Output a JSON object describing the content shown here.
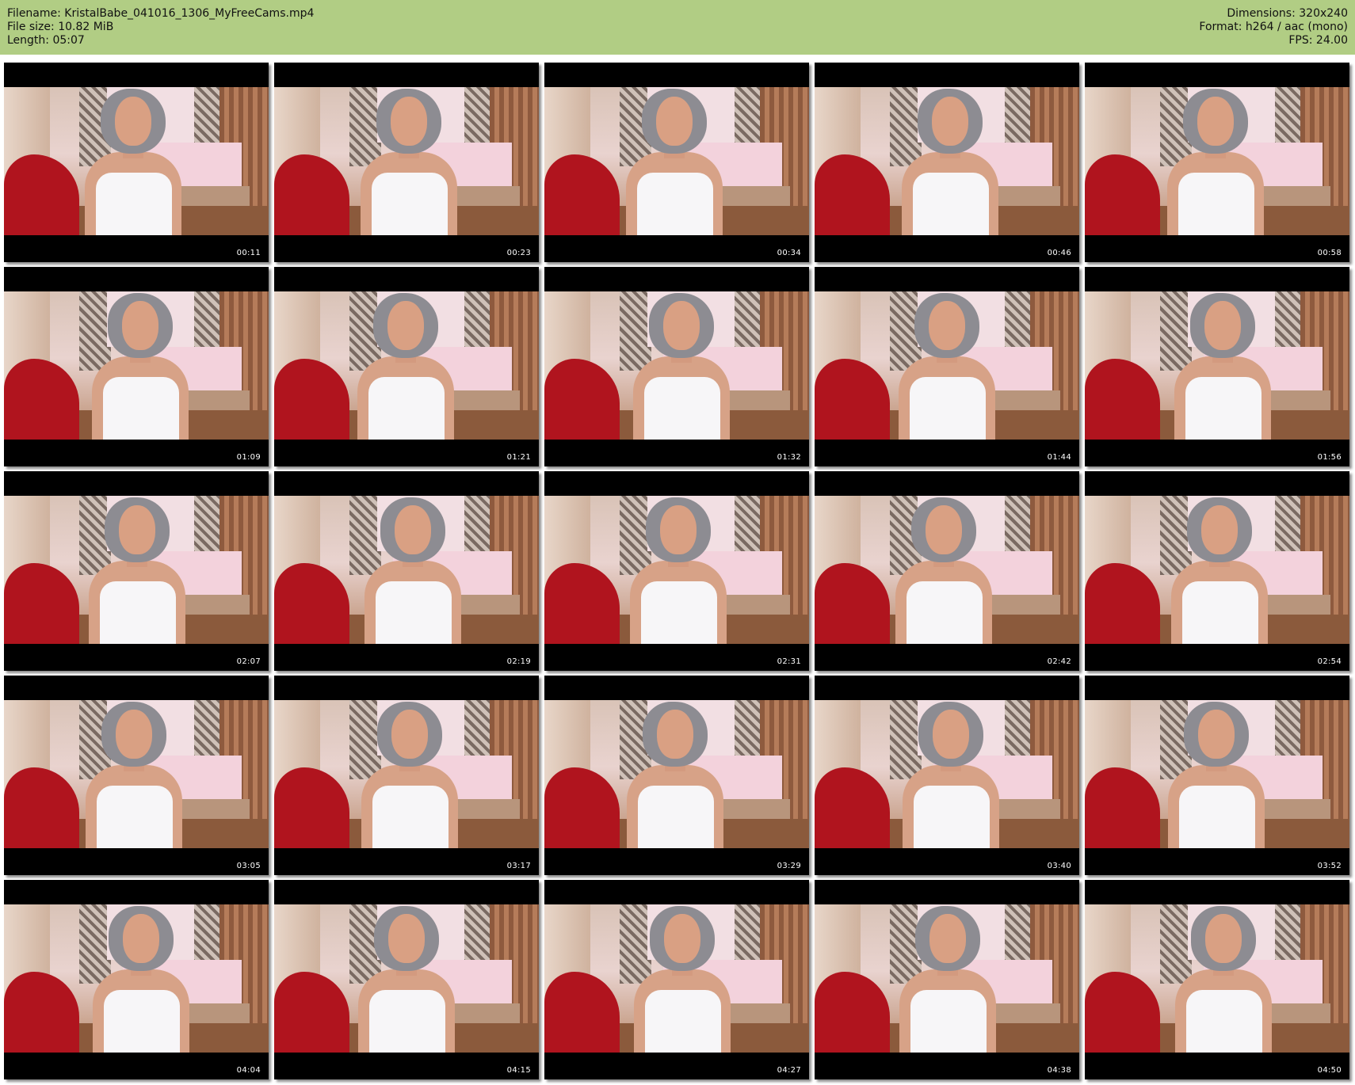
{
  "meta": {
    "filename": "Filename: KristalBabe_041016_1306_MyFreeCams.mp4",
    "filesize": "File size: 10.82 MiB",
    "length": "Length: 05:07",
    "dimensions": "Dimensions: 320x240",
    "format": "Format: h264 / aac (mono)",
    "fps": "FPS: 24.00"
  },
  "colors": {
    "header_bg": "#b1cd84",
    "thumb_frame": "#000000"
  },
  "thumbnails": [
    "00:11",
    "00:23",
    "00:34",
    "00:46",
    "00:58",
    "01:09",
    "01:21",
    "01:32",
    "01:44",
    "01:56",
    "02:07",
    "02:19",
    "02:31",
    "02:42",
    "02:54",
    "03:05",
    "03:17",
    "03:29",
    "03:40",
    "03:52",
    "04:04",
    "04:15",
    "04:27",
    "04:38",
    "04:50"
  ]
}
